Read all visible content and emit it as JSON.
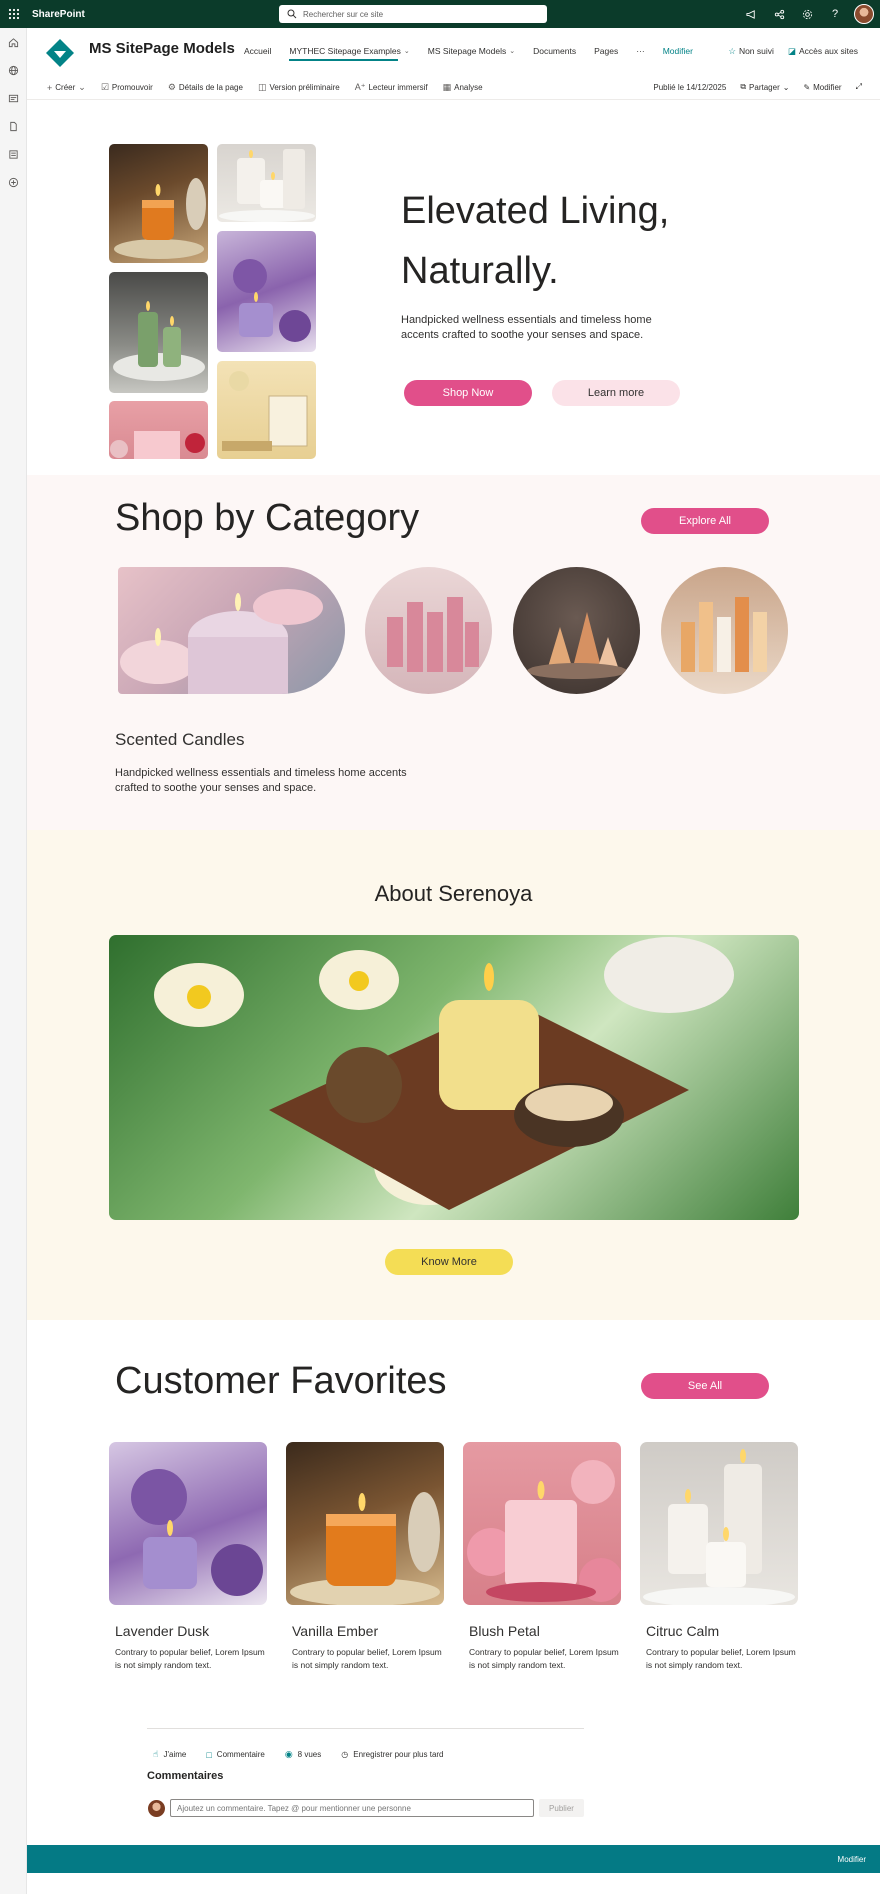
{
  "suite": {
    "brand": "SharePoint",
    "search_placeholder": "Rechercher sur ce site"
  },
  "site": {
    "title": "MS SitePage Models",
    "nav": [
      {
        "label": "Accueil",
        "has_menu": false
      },
      {
        "label": "MYTHEC Sitepage Examples",
        "has_menu": true,
        "active": true
      },
      {
        "label": "MS Sitepage Models",
        "has_menu": true
      },
      {
        "label": "Documents",
        "has_menu": false
      },
      {
        "label": "Pages",
        "has_menu": false
      },
      {
        "label": "···",
        "has_menu": false
      }
    ],
    "edit_link": "Modifier",
    "follow": "Non suivi",
    "site_access": "Accès aux sites"
  },
  "command_bar": {
    "left": [
      "Créer",
      "Promouvoir",
      "Détails de la page",
      "Version préliminaire",
      "Lecteur immersif",
      "Analyse"
    ],
    "published": "Publié le 14/12/2025",
    "share": "Partager",
    "edit": "Modifier"
  },
  "hero": {
    "title_line1": "Elevated Living,",
    "title_line2": "Naturally.",
    "subtitle": "Handpicked wellness essentials and timeless home accents crafted to soothe your senses and space.",
    "shop_now": "Shop Now",
    "learn_more": "Learn more"
  },
  "category": {
    "title": "Shop by Category",
    "explore_all": "Explore All",
    "item_name": "Scented Candles",
    "item_desc": "Handpicked wellness essentials and timeless home accents crafted to soothe your senses and space."
  },
  "about": {
    "title": "About Serenoya",
    "know_more": "Know More"
  },
  "favorites": {
    "title": "Customer Favorites",
    "see_all": "See All",
    "items": [
      {
        "name": "Lavender Dusk",
        "desc": "Contrary to popular belief, Lorem Ipsum is not simply random text."
      },
      {
        "name": "Vanilla Ember",
        "desc": "Contrary to popular belief, Lorem Ipsum is not simply random text."
      },
      {
        "name": "Blush Petal",
        "desc": "Contrary to popular belief, Lorem Ipsum is not simply random text."
      },
      {
        "name": "Citruc Calm",
        "desc": "Contrary to popular belief, Lorem Ipsum is not simply random text."
      }
    ]
  },
  "social": {
    "like": "J'aime",
    "comment": "Commentaire",
    "views": "8 vues",
    "save": "Enregistrer pour plus tard",
    "comments_title": "Commentaires",
    "comment_placeholder": "Ajoutez un commentaire. Tapez @ pour mentionner une personne",
    "publish": "Publier"
  },
  "footer": {
    "edit": "Modifier"
  },
  "colors": {
    "suite_bar": "#0b3b2a",
    "accent_teal": "#038387",
    "pink_button": "#e14f8a",
    "yellow_button": "#f4dd55",
    "footer": "#047a85"
  }
}
